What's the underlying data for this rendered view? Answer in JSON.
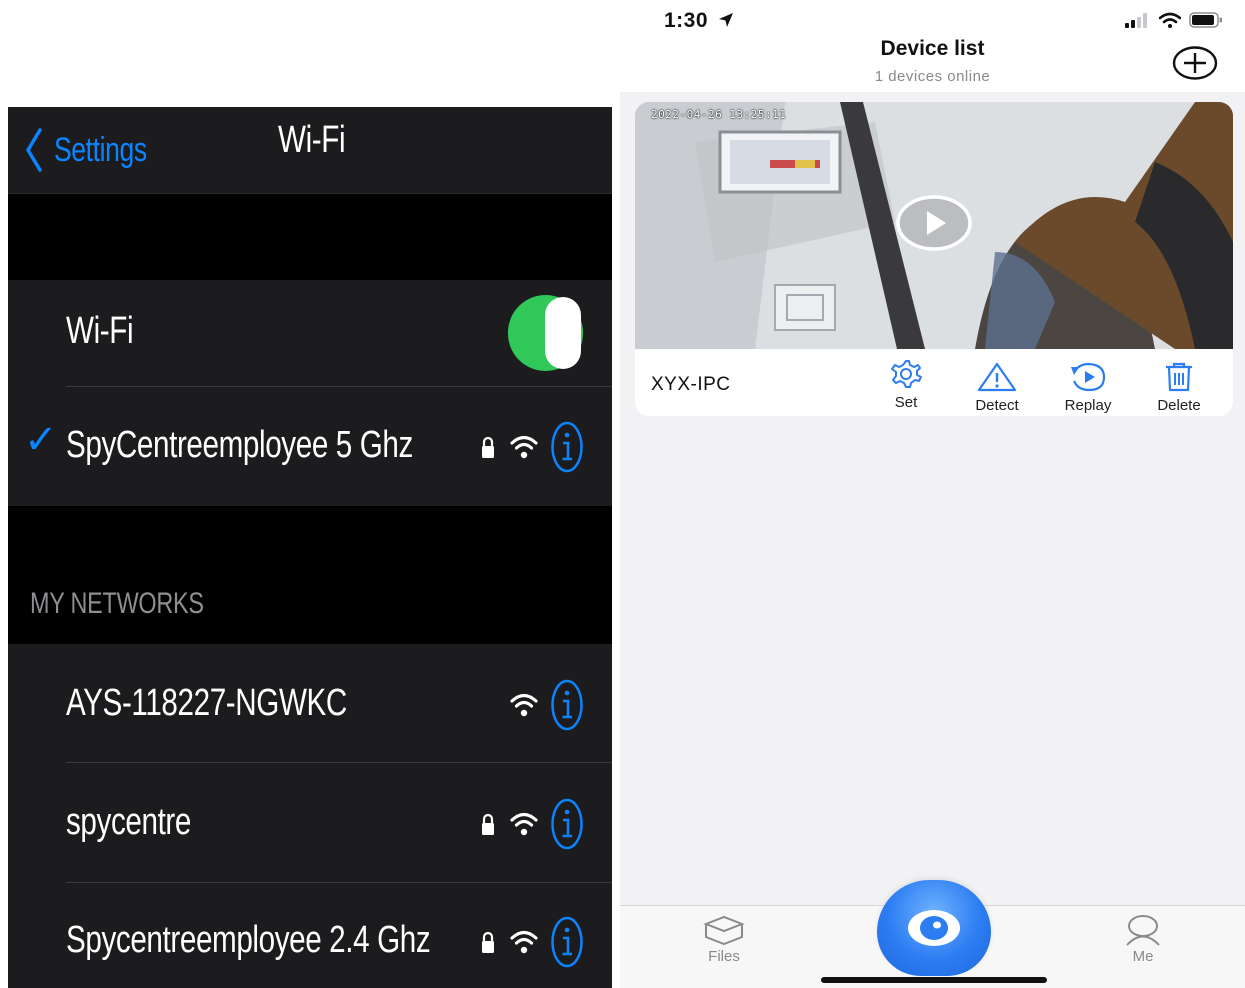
{
  "wifi_settings": {
    "back_label": "Settings",
    "title": "Wi-Fi",
    "wifi_row_label": "Wi-Fi",
    "wifi_enabled": true,
    "connected_network": {
      "name": "SpyCentreemployee 5 Ghz",
      "secured": true,
      "checkmark": "✓"
    },
    "my_networks_header": "MY NETWORKS",
    "my_networks": [
      {
        "name": "AYS-118227-NGWKC",
        "secured": false
      },
      {
        "name": "spycentre",
        "secured": true
      },
      {
        "name": "Spycentreemployee 2.4 Ghz",
        "secured": true
      }
    ],
    "accent_color": "#0a84ff",
    "toggle_color": "#31c85a"
  },
  "device_app": {
    "status_bar": {
      "time": "1:30"
    },
    "header": {
      "title": "Device list",
      "subtitle": "1 devices online",
      "add_icon": "plus-circle-icon"
    },
    "devices": [
      {
        "name": "XYX-IPC",
        "timestamp": "2022-04-26 13:25:11",
        "actions": [
          {
            "label": "Set",
            "icon": "gear-icon"
          },
          {
            "label": "Detect",
            "icon": "warning-icon"
          },
          {
            "label": "Replay",
            "icon": "replay-icon"
          },
          {
            "label": "Delete",
            "icon": "trash-icon"
          }
        ]
      }
    ],
    "tabbar": {
      "files_label": "Files",
      "me_label": "Me",
      "center_icon": "eye-icon"
    },
    "accent_color": "#2d7df2"
  }
}
